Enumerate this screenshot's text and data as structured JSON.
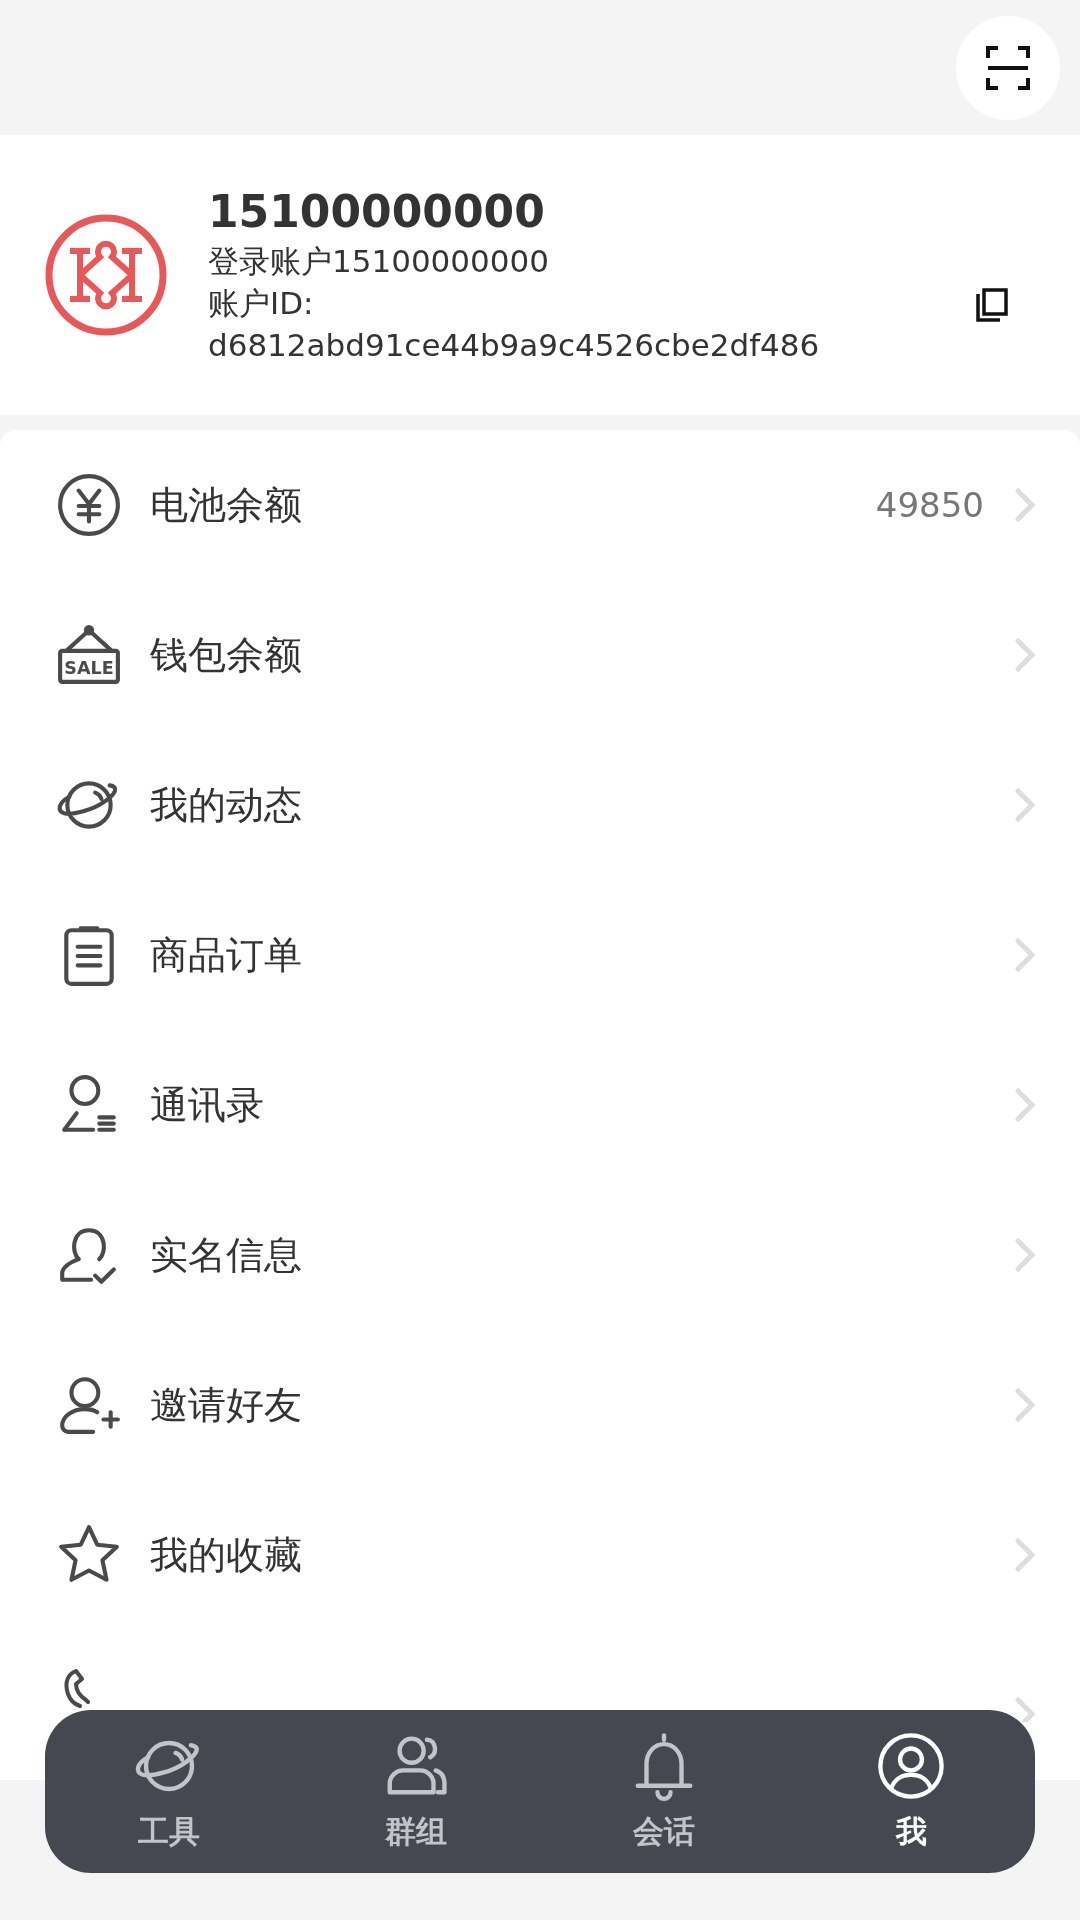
{
  "profile": {
    "name": "15100000000",
    "login": "登录账户15100000000",
    "id_label": "账户ID:",
    "id_value": "d6812abd91ce44b9a9c4526cbe2df486"
  },
  "menu": [
    {
      "kind": "yuan",
      "label": "电池余额",
      "value": "49850"
    },
    {
      "kind": "sale",
      "icon_text": "SALE",
      "label": "钱包余额"
    },
    {
      "kind": "planet",
      "label": "我的动态"
    },
    {
      "kind": "clipboard",
      "label": "商品订单"
    },
    {
      "kind": "contacts",
      "label": "通讯录"
    },
    {
      "kind": "verified",
      "label": "实名信息"
    },
    {
      "kind": "adduser",
      "label": "邀请好友"
    },
    {
      "kind": "star",
      "label": "我的收藏"
    },
    {
      "kind": "phone"
    }
  ],
  "tabbar": [
    {
      "kind": "planet",
      "label": "工具",
      "selected": false
    },
    {
      "kind": "group",
      "label": "群组",
      "selected": false
    },
    {
      "kind": "bell",
      "label": "会话",
      "selected": false
    },
    {
      "kind": "user",
      "label": "我",
      "selected": true
    }
  ]
}
